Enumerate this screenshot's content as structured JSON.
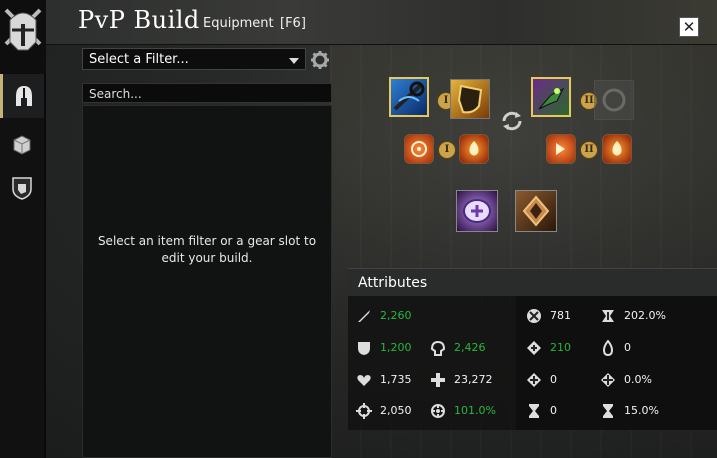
{
  "window": {
    "title": "PvP Build",
    "subtitle": "Equipment",
    "hotkey": "[F6]",
    "close_label": "✕"
  },
  "filter": {
    "placeholder": "Select a Filter..."
  },
  "search": {
    "placeholder": "Search..."
  },
  "list": {
    "empty_message_line1": "Select an item filter or a gear slot to",
    "empty_message_line2": "edit your build."
  },
  "weapon_sets": {
    "set1_badge": "I",
    "set1_sigil_badge": "I",
    "set2_badge": "II",
    "set2_sigil_badge": "II"
  },
  "attributes": {
    "header": "Attributes",
    "power": "2,260",
    "toughness": "1,200",
    "armor": "2,426",
    "vitality": "1,735",
    "health": "23,272",
    "precision": "2,050",
    "critical_chance": "101.0%",
    "ferocity": "781",
    "critical_damage": "202.0%",
    "condition_damage": "210",
    "condition_duration": "0",
    "healing_power": "0",
    "boon_duration": "0.0%",
    "concentration": "0",
    "expertise": "15.0%"
  },
  "colors": {
    "positive": "#27b83a",
    "neutral": "#f2f2f2",
    "accent": "#c9b27a"
  }
}
